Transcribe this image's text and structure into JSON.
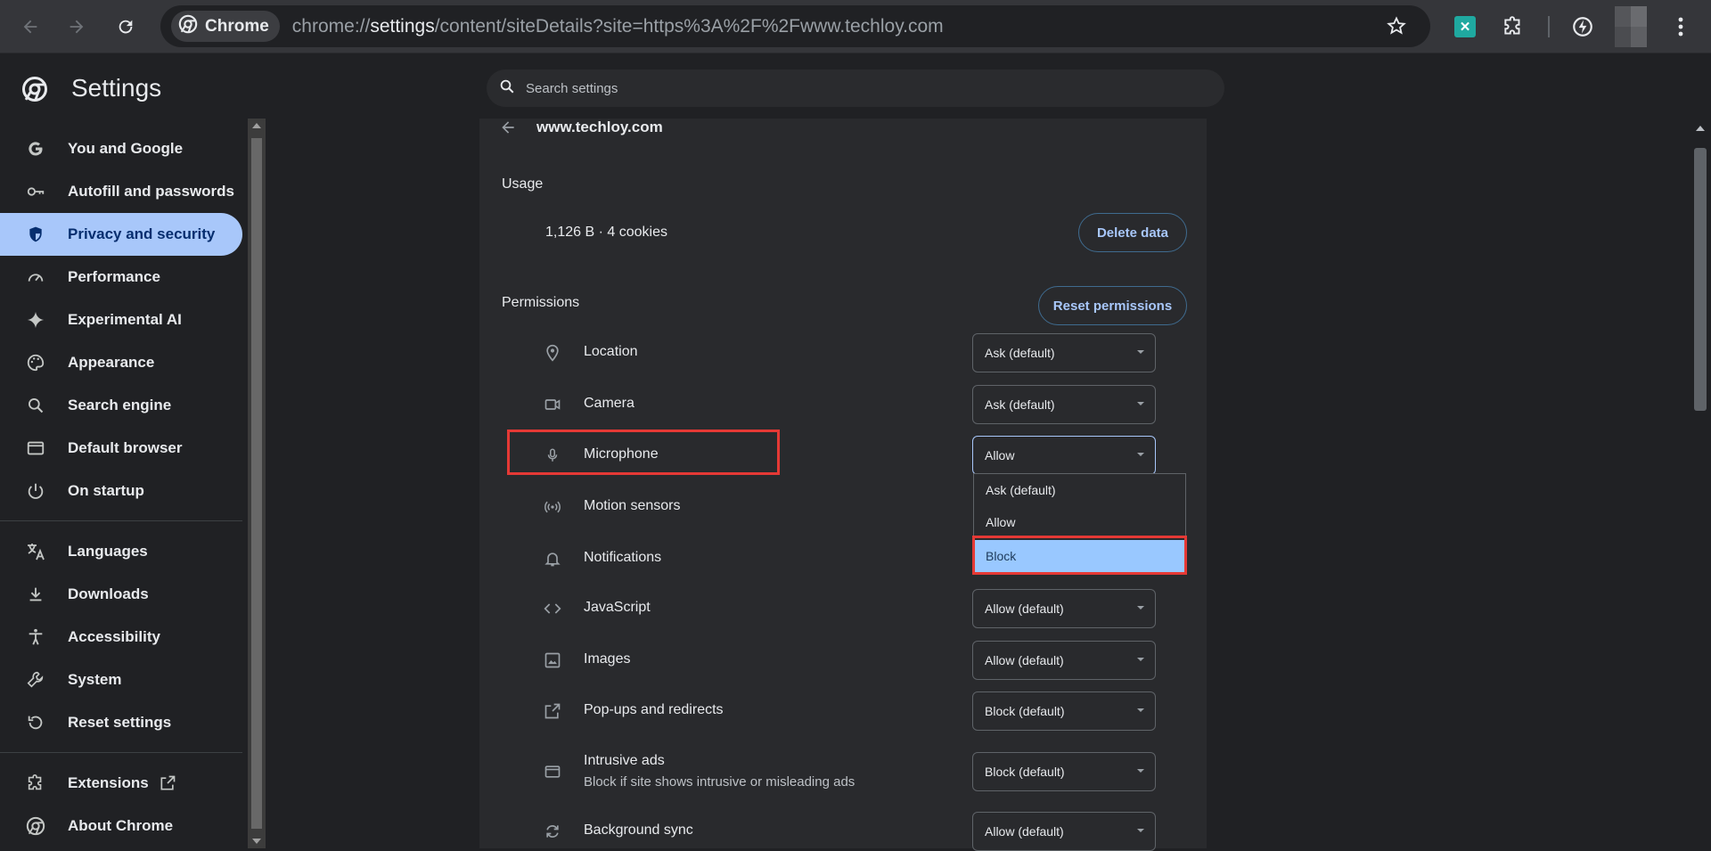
{
  "browser": {
    "chip_label": "Chrome",
    "url_prefix": "chrome://",
    "url_host": "settings",
    "url_rest": "/content/siteDetails?site=https%3A%2F%2Fwww.techloy.com"
  },
  "header": {
    "title": "Settings",
    "search_placeholder": "Search settings"
  },
  "sidebar": {
    "items": [
      {
        "label": "You and Google",
        "icon": "google-g-icon"
      },
      {
        "label": "Autofill and passwords",
        "icon": "key-icon"
      },
      {
        "label": "Privacy and security",
        "icon": "shield-icon",
        "active": true
      },
      {
        "label": "Performance",
        "icon": "speedometer-icon"
      },
      {
        "label": "Experimental AI",
        "icon": "sparkle-icon"
      },
      {
        "label": "Appearance",
        "icon": "palette-icon"
      },
      {
        "label": "Search engine",
        "icon": "search-icon"
      },
      {
        "label": "Default browser",
        "icon": "browser-window-icon"
      },
      {
        "label": "On startup",
        "icon": "power-icon"
      },
      {
        "label": "Languages",
        "icon": "translate-icon"
      },
      {
        "label": "Downloads",
        "icon": "download-icon"
      },
      {
        "label": "Accessibility",
        "icon": "accessibility-icon"
      },
      {
        "label": "System",
        "icon": "wrench-icon"
      },
      {
        "label": "Reset settings",
        "icon": "reset-icon"
      },
      {
        "label": "Extensions",
        "icon": "puzzle-icon"
      },
      {
        "label": "About Chrome",
        "icon": "chrome-logo-icon"
      }
    ]
  },
  "site": {
    "name": "www.techloy.com",
    "usage_heading": "Usage",
    "usage_value": "1,126 B · 4 cookies",
    "delete_label": "Delete data",
    "permissions_heading": "Permissions",
    "reset_label": "Reset permissions"
  },
  "permissions": [
    {
      "label": "Location",
      "value": "Ask (default)",
      "icon": "location-pin-icon"
    },
    {
      "label": "Camera",
      "value": "Ask (default)",
      "icon": "camera-icon"
    },
    {
      "label": "Microphone",
      "value": "Allow",
      "icon": "microphone-icon"
    },
    {
      "label": "Motion sensors",
      "value": "",
      "icon": "motion-sensors-icon"
    },
    {
      "label": "Notifications",
      "value": "",
      "icon": "bell-icon"
    },
    {
      "label": "JavaScript",
      "value": "Allow (default)",
      "icon": "code-icon"
    },
    {
      "label": "Images",
      "value": "Allow (default)",
      "icon": "image-icon"
    },
    {
      "label": "Pop-ups and redirects",
      "value": "Block (default)",
      "icon": "open-external-icon"
    },
    {
      "label": "Intrusive ads",
      "sublabel": "Block if site shows intrusive or misleading ads",
      "value": "Block (default)",
      "icon": "ad-window-icon"
    },
    {
      "label": "Background sync",
      "value": "Allow (default)",
      "icon": "sync-icon"
    }
  ],
  "dropdown": {
    "options": [
      "Ask (default)",
      "Allow",
      "Block"
    ],
    "highlighted": "Block"
  }
}
